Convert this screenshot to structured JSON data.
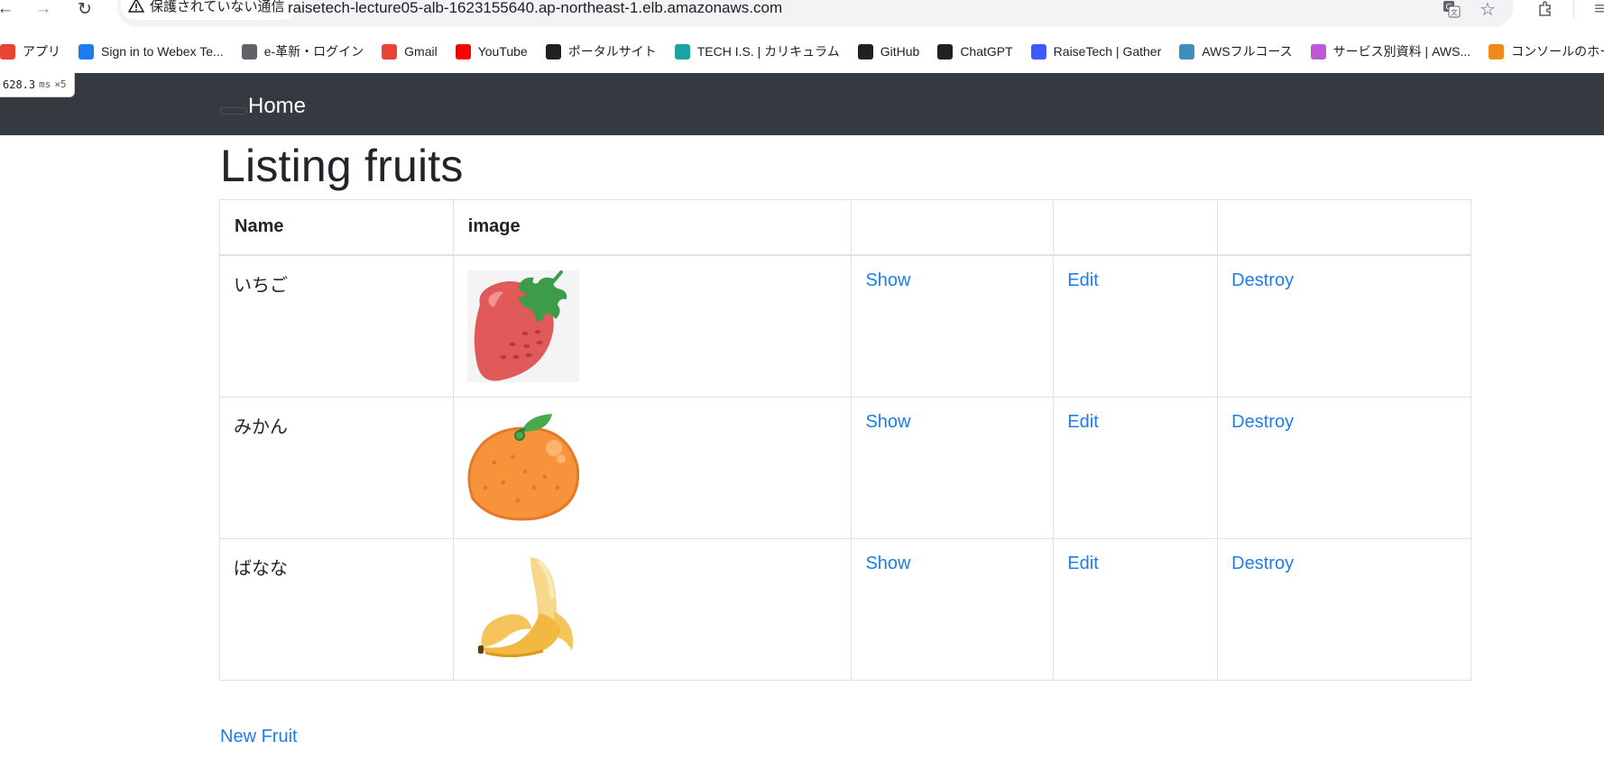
{
  "browser": {
    "security_label": "保護されていない通信",
    "url": "raisetech-lecture05-alb-1623155640.ap-northeast-1.elb.amazonaws.com",
    "icons": [
      "back-icon",
      "forward-icon",
      "reload-icon",
      "translate-icon",
      "star-icon",
      "extensions-icon"
    ]
  },
  "bookmarks": [
    {
      "label": "アプリ",
      "icon": "apps-grid-icon",
      "color": "#ea4335"
    },
    {
      "label": "Sign in to Webex Te...",
      "icon": "webex-icon",
      "color": "#1f7cf0"
    },
    {
      "label": "e-革新・ログイン",
      "icon": "globe-icon",
      "color": "#5f6368"
    },
    {
      "label": "Gmail",
      "icon": "gmail-icon",
      "color": "#ea4335"
    },
    {
      "label": "YouTube",
      "icon": "youtube-icon",
      "color": "#ff0000"
    },
    {
      "label": "ポータルサイト",
      "icon": "notion-icon",
      "color": "#202124"
    },
    {
      "label": "TECH I.S. | カリキュラム",
      "icon": "techis-icon",
      "color": "#1aa3a3"
    },
    {
      "label": "GitHub",
      "icon": "github-icon",
      "color": "#202124"
    },
    {
      "label": "ChatGPT",
      "icon": "chatgpt-icon",
      "color": "#202124"
    },
    {
      "label": "RaiseTech | Gather",
      "icon": "raisetech-icon",
      "color": "#3b5bff"
    },
    {
      "label": "AWSフルコース",
      "icon": "aws-course-icon",
      "color": "#3f8fbd"
    },
    {
      "label": "サービス別資料 | AWS...",
      "icon": "cube-icon",
      "color": "#c058d6"
    },
    {
      "label": "コンソールのホーム | コン...",
      "icon": "aws-console-icon",
      "color": "#f08a1c"
    }
  ],
  "perf": {
    "value": "628.3",
    "unit": "ms",
    "multiplier": "×5"
  },
  "navbar": {
    "home_label": "Home"
  },
  "page": {
    "title": "Listing fruits",
    "new_link": "New Fruit"
  },
  "table": {
    "headers": [
      "Name",
      "image",
      "",
      "",
      ""
    ],
    "rows": [
      {
        "name": "いちご",
        "image": "strawberry-image",
        "show": "Show",
        "edit": "Edit",
        "destroy": "Destroy"
      },
      {
        "name": "みかん",
        "image": "orange-image",
        "show": "Show",
        "edit": "Edit",
        "destroy": "Destroy"
      },
      {
        "name": "ばなな",
        "image": "banana-image",
        "show": "Show",
        "edit": "Edit",
        "destroy": "Destroy"
      }
    ]
  },
  "colors": {
    "navbar": "#343a40",
    "link": "#1f7cf0",
    "border": "#dee2e6"
  }
}
